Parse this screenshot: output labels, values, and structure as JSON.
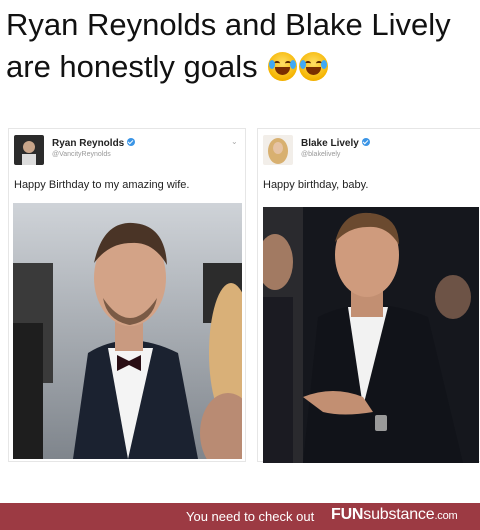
{
  "caption": {
    "text": "Ryan Reynolds and Blake Lively are honestly goals",
    "emojis": [
      "face-with-tears-of-joy-icon",
      "face-with-tears-of-joy-icon"
    ]
  },
  "tweets": [
    {
      "name": "Ryan Reynolds",
      "handle": "@VancityReynolds",
      "verified": true,
      "text": "Happy Birthday to my amazing wife."
    },
    {
      "name": "Blake Lively",
      "handle": "@blakelively",
      "verified": true,
      "text": "Happy birthday, baby."
    }
  ],
  "footer": {
    "text": "You need to check out",
    "brand_bold": "FUN",
    "brand_light": "substance",
    "brand_suffix": ".com",
    "color": "#9c3a43"
  }
}
